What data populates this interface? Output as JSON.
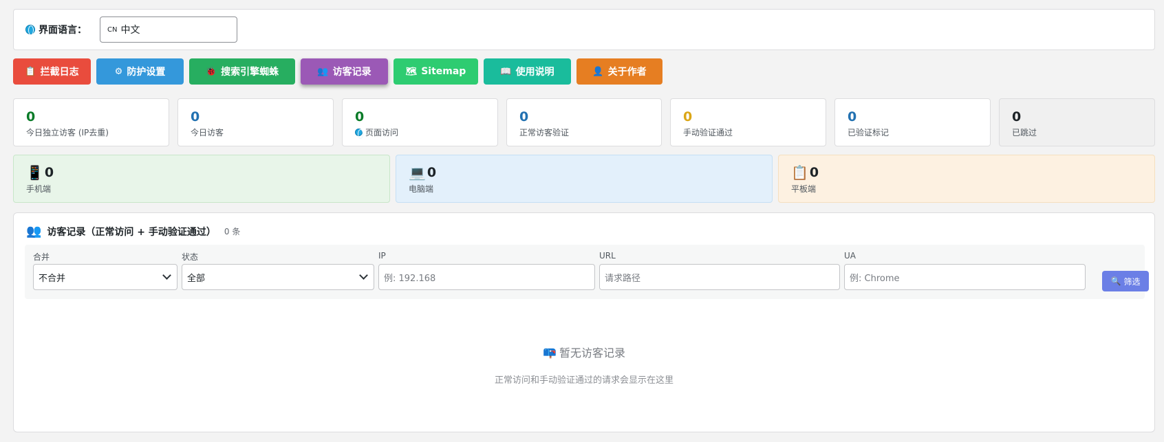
{
  "language": {
    "label": "界面语言：",
    "code": "CN",
    "value": "中文"
  },
  "tabs": [
    {
      "label": "拦截日志",
      "icon": "clipboard-icon",
      "color": "#e94c3d"
    },
    {
      "label": "防护设置",
      "icon": "gear-icon",
      "color": "#3498db"
    },
    {
      "label": "搜索引擎蜘蛛",
      "icon": "bug-icon",
      "color": "#27ae60"
    },
    {
      "label": "访客记录",
      "icon": "users-icon",
      "color": "#9b59b6",
      "active": true
    },
    {
      "label": "Sitemap",
      "icon": "map-icon",
      "color": "#2ecc71"
    },
    {
      "label": "使用说明",
      "icon": "book-icon",
      "color": "#1abc9c"
    },
    {
      "label": "关于作者",
      "icon": "user-icon",
      "color": "#e67e22"
    }
  ],
  "stats": [
    {
      "value": "0",
      "label": "今日独立访客 (IP去重)",
      "color": "#0a7b28"
    },
    {
      "value": "0",
      "label": "今日访客",
      "color": "#2271b1"
    },
    {
      "value": "0",
      "label": "页面访问",
      "color": "#0a7b28",
      "icon": "globe-icon"
    },
    {
      "value": "0",
      "label": "正常访客验证",
      "color": "#2271b1"
    },
    {
      "value": "0",
      "label": "手动验证通过",
      "color": "#dba617"
    },
    {
      "value": "0",
      "label": "已验证标记",
      "color": "#2271b1"
    },
    {
      "value": "0",
      "label": "已跳过",
      "color": "#1d2327"
    }
  ],
  "devices": [
    {
      "value": "0",
      "label": "手机端",
      "icon": "mobile-icon",
      "bg": "#e8f5e9"
    },
    {
      "value": "0",
      "label": "电脑端",
      "icon": "laptop-icon",
      "bg": "#e3f0fb"
    },
    {
      "value": "0",
      "label": "平板端",
      "icon": "tablet-icon",
      "bg": "#fdf1e1"
    }
  ],
  "records": {
    "title": "访客记录（正常访问 + 手动验证通过）",
    "count": "0 条",
    "filters": {
      "merge": {
        "label": "合并",
        "value": "不合并"
      },
      "status": {
        "label": "状态",
        "value": "全部"
      },
      "ip": {
        "label": "IP",
        "placeholder": "例: 192.168"
      },
      "url": {
        "label": "URL",
        "placeholder": "请求路径"
      },
      "ua": {
        "label": "UA",
        "placeholder": "例: Chrome"
      },
      "button": "筛选"
    },
    "empty": {
      "title": "暂无访客记录",
      "subtitle": "正常访问和手动验证通过的请求会显示在这里"
    }
  }
}
